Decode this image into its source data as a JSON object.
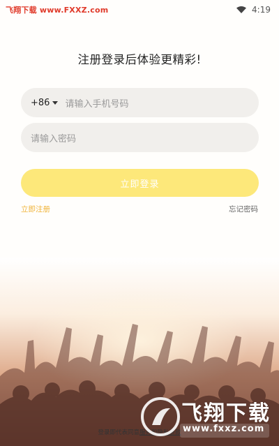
{
  "status_bar": {
    "watermark": "飞翔下载 www.FXXZ.com",
    "time": "4:19",
    "wifi_icon": "wifi-icon"
  },
  "headline": "注册登录后体验更精彩!",
  "phone_field": {
    "country_code": "+86",
    "placeholder": "请输入手机号码"
  },
  "password_field": {
    "placeholder": "请输入密码"
  },
  "login_button": "立即登录",
  "register_link": "立即注册",
  "forgot_link": "忘记密码",
  "agreement": {
    "text": "登录即代表同意",
    "link": "服务和隐私条款"
  },
  "logo": {
    "title": "飞翔下载",
    "url": "www.fxxz.com"
  },
  "colors": {
    "accent": "#fde87a",
    "register_link": "#f0b43a",
    "watermark": "#e03a2a"
  }
}
